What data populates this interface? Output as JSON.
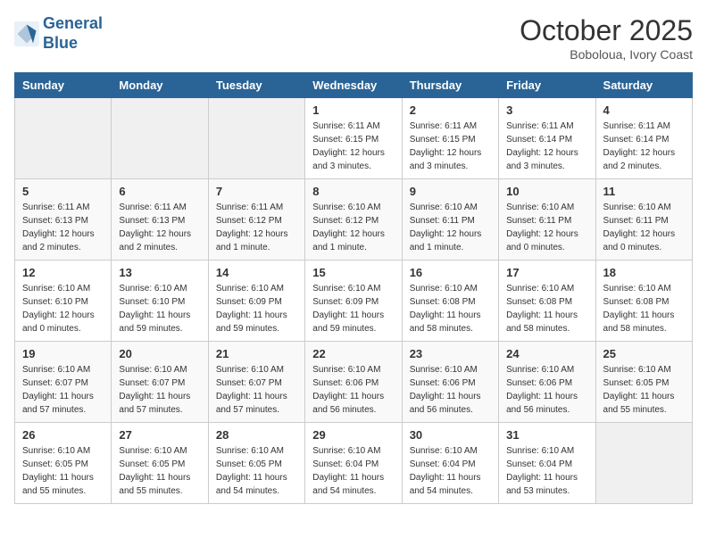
{
  "header": {
    "logo_line1": "General",
    "logo_line2": "Blue",
    "month": "October 2025",
    "location": "Boboloua, Ivory Coast"
  },
  "weekdays": [
    "Sunday",
    "Monday",
    "Tuesday",
    "Wednesday",
    "Thursday",
    "Friday",
    "Saturday"
  ],
  "weeks": [
    [
      {
        "day": "",
        "info": ""
      },
      {
        "day": "",
        "info": ""
      },
      {
        "day": "",
        "info": ""
      },
      {
        "day": "1",
        "info": "Sunrise: 6:11 AM\nSunset: 6:15 PM\nDaylight: 12 hours and 3 minutes."
      },
      {
        "day": "2",
        "info": "Sunrise: 6:11 AM\nSunset: 6:15 PM\nDaylight: 12 hours and 3 minutes."
      },
      {
        "day": "3",
        "info": "Sunrise: 6:11 AM\nSunset: 6:14 PM\nDaylight: 12 hours and 3 minutes."
      },
      {
        "day": "4",
        "info": "Sunrise: 6:11 AM\nSunset: 6:14 PM\nDaylight: 12 hours and 2 minutes."
      }
    ],
    [
      {
        "day": "5",
        "info": "Sunrise: 6:11 AM\nSunset: 6:13 PM\nDaylight: 12 hours and 2 minutes."
      },
      {
        "day": "6",
        "info": "Sunrise: 6:11 AM\nSunset: 6:13 PM\nDaylight: 12 hours and 2 minutes."
      },
      {
        "day": "7",
        "info": "Sunrise: 6:11 AM\nSunset: 6:12 PM\nDaylight: 12 hours and 1 minute."
      },
      {
        "day": "8",
        "info": "Sunrise: 6:10 AM\nSunset: 6:12 PM\nDaylight: 12 hours and 1 minute."
      },
      {
        "day": "9",
        "info": "Sunrise: 6:10 AM\nSunset: 6:11 PM\nDaylight: 12 hours and 1 minute."
      },
      {
        "day": "10",
        "info": "Sunrise: 6:10 AM\nSunset: 6:11 PM\nDaylight: 12 hours and 0 minutes."
      },
      {
        "day": "11",
        "info": "Sunrise: 6:10 AM\nSunset: 6:11 PM\nDaylight: 12 hours and 0 minutes."
      }
    ],
    [
      {
        "day": "12",
        "info": "Sunrise: 6:10 AM\nSunset: 6:10 PM\nDaylight: 12 hours and 0 minutes."
      },
      {
        "day": "13",
        "info": "Sunrise: 6:10 AM\nSunset: 6:10 PM\nDaylight: 11 hours and 59 minutes."
      },
      {
        "day": "14",
        "info": "Sunrise: 6:10 AM\nSunset: 6:09 PM\nDaylight: 11 hours and 59 minutes."
      },
      {
        "day": "15",
        "info": "Sunrise: 6:10 AM\nSunset: 6:09 PM\nDaylight: 11 hours and 59 minutes."
      },
      {
        "day": "16",
        "info": "Sunrise: 6:10 AM\nSunset: 6:08 PM\nDaylight: 11 hours and 58 minutes."
      },
      {
        "day": "17",
        "info": "Sunrise: 6:10 AM\nSunset: 6:08 PM\nDaylight: 11 hours and 58 minutes."
      },
      {
        "day": "18",
        "info": "Sunrise: 6:10 AM\nSunset: 6:08 PM\nDaylight: 11 hours and 58 minutes."
      }
    ],
    [
      {
        "day": "19",
        "info": "Sunrise: 6:10 AM\nSunset: 6:07 PM\nDaylight: 11 hours and 57 minutes."
      },
      {
        "day": "20",
        "info": "Sunrise: 6:10 AM\nSunset: 6:07 PM\nDaylight: 11 hours and 57 minutes."
      },
      {
        "day": "21",
        "info": "Sunrise: 6:10 AM\nSunset: 6:07 PM\nDaylight: 11 hours and 57 minutes."
      },
      {
        "day": "22",
        "info": "Sunrise: 6:10 AM\nSunset: 6:06 PM\nDaylight: 11 hours and 56 minutes."
      },
      {
        "day": "23",
        "info": "Sunrise: 6:10 AM\nSunset: 6:06 PM\nDaylight: 11 hours and 56 minutes."
      },
      {
        "day": "24",
        "info": "Sunrise: 6:10 AM\nSunset: 6:06 PM\nDaylight: 11 hours and 56 minutes."
      },
      {
        "day": "25",
        "info": "Sunrise: 6:10 AM\nSunset: 6:05 PM\nDaylight: 11 hours and 55 minutes."
      }
    ],
    [
      {
        "day": "26",
        "info": "Sunrise: 6:10 AM\nSunset: 6:05 PM\nDaylight: 11 hours and 55 minutes."
      },
      {
        "day": "27",
        "info": "Sunrise: 6:10 AM\nSunset: 6:05 PM\nDaylight: 11 hours and 55 minutes."
      },
      {
        "day": "28",
        "info": "Sunrise: 6:10 AM\nSunset: 6:05 PM\nDaylight: 11 hours and 54 minutes."
      },
      {
        "day": "29",
        "info": "Sunrise: 6:10 AM\nSunset: 6:04 PM\nDaylight: 11 hours and 54 minutes."
      },
      {
        "day": "30",
        "info": "Sunrise: 6:10 AM\nSunset: 6:04 PM\nDaylight: 11 hours and 54 minutes."
      },
      {
        "day": "31",
        "info": "Sunrise: 6:10 AM\nSunset: 6:04 PM\nDaylight: 11 hours and 53 minutes."
      },
      {
        "day": "",
        "info": ""
      }
    ]
  ]
}
